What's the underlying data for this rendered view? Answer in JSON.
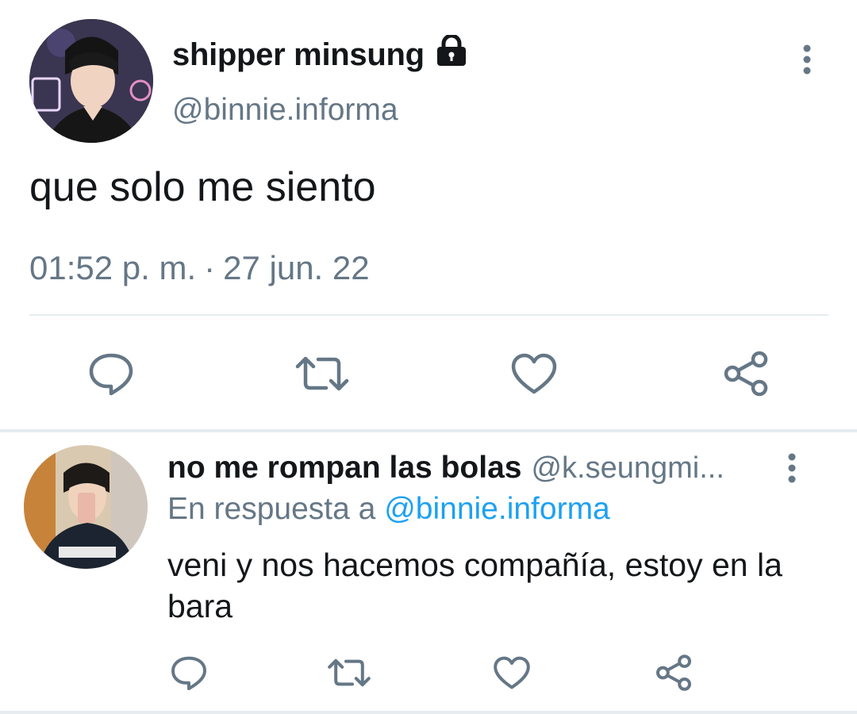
{
  "tweet": {
    "display_name": "shipper minsung",
    "locked_icon": "lock-icon",
    "handle": "@binnie.informa",
    "text": "que solo me siento",
    "time": "01:52 p. m.",
    "separator": "·",
    "date": "27 jun. 22",
    "more_icon": "vertical-dots-icon",
    "actions": [
      {
        "name": "reply",
        "icon": "reply-bubble-icon"
      },
      {
        "name": "retweet",
        "icon": "retweet-icon"
      },
      {
        "name": "like",
        "icon": "heart-icon"
      },
      {
        "name": "share",
        "icon": "share-icon"
      }
    ]
  },
  "reply": {
    "display_name": "no me rompan las bolas",
    "handle": "@k.seungmi...",
    "reply_prefix": "En respuesta a",
    "reply_mention": "@binnie.informa",
    "text": "veni y nos hacemos compañía, estoy en la bara",
    "more_icon": "vertical-dots-icon"
  },
  "colors": {
    "text": "#14171a",
    "secondary": "#657786",
    "link": "#1da1f2",
    "divider": "#e6ecf0"
  }
}
